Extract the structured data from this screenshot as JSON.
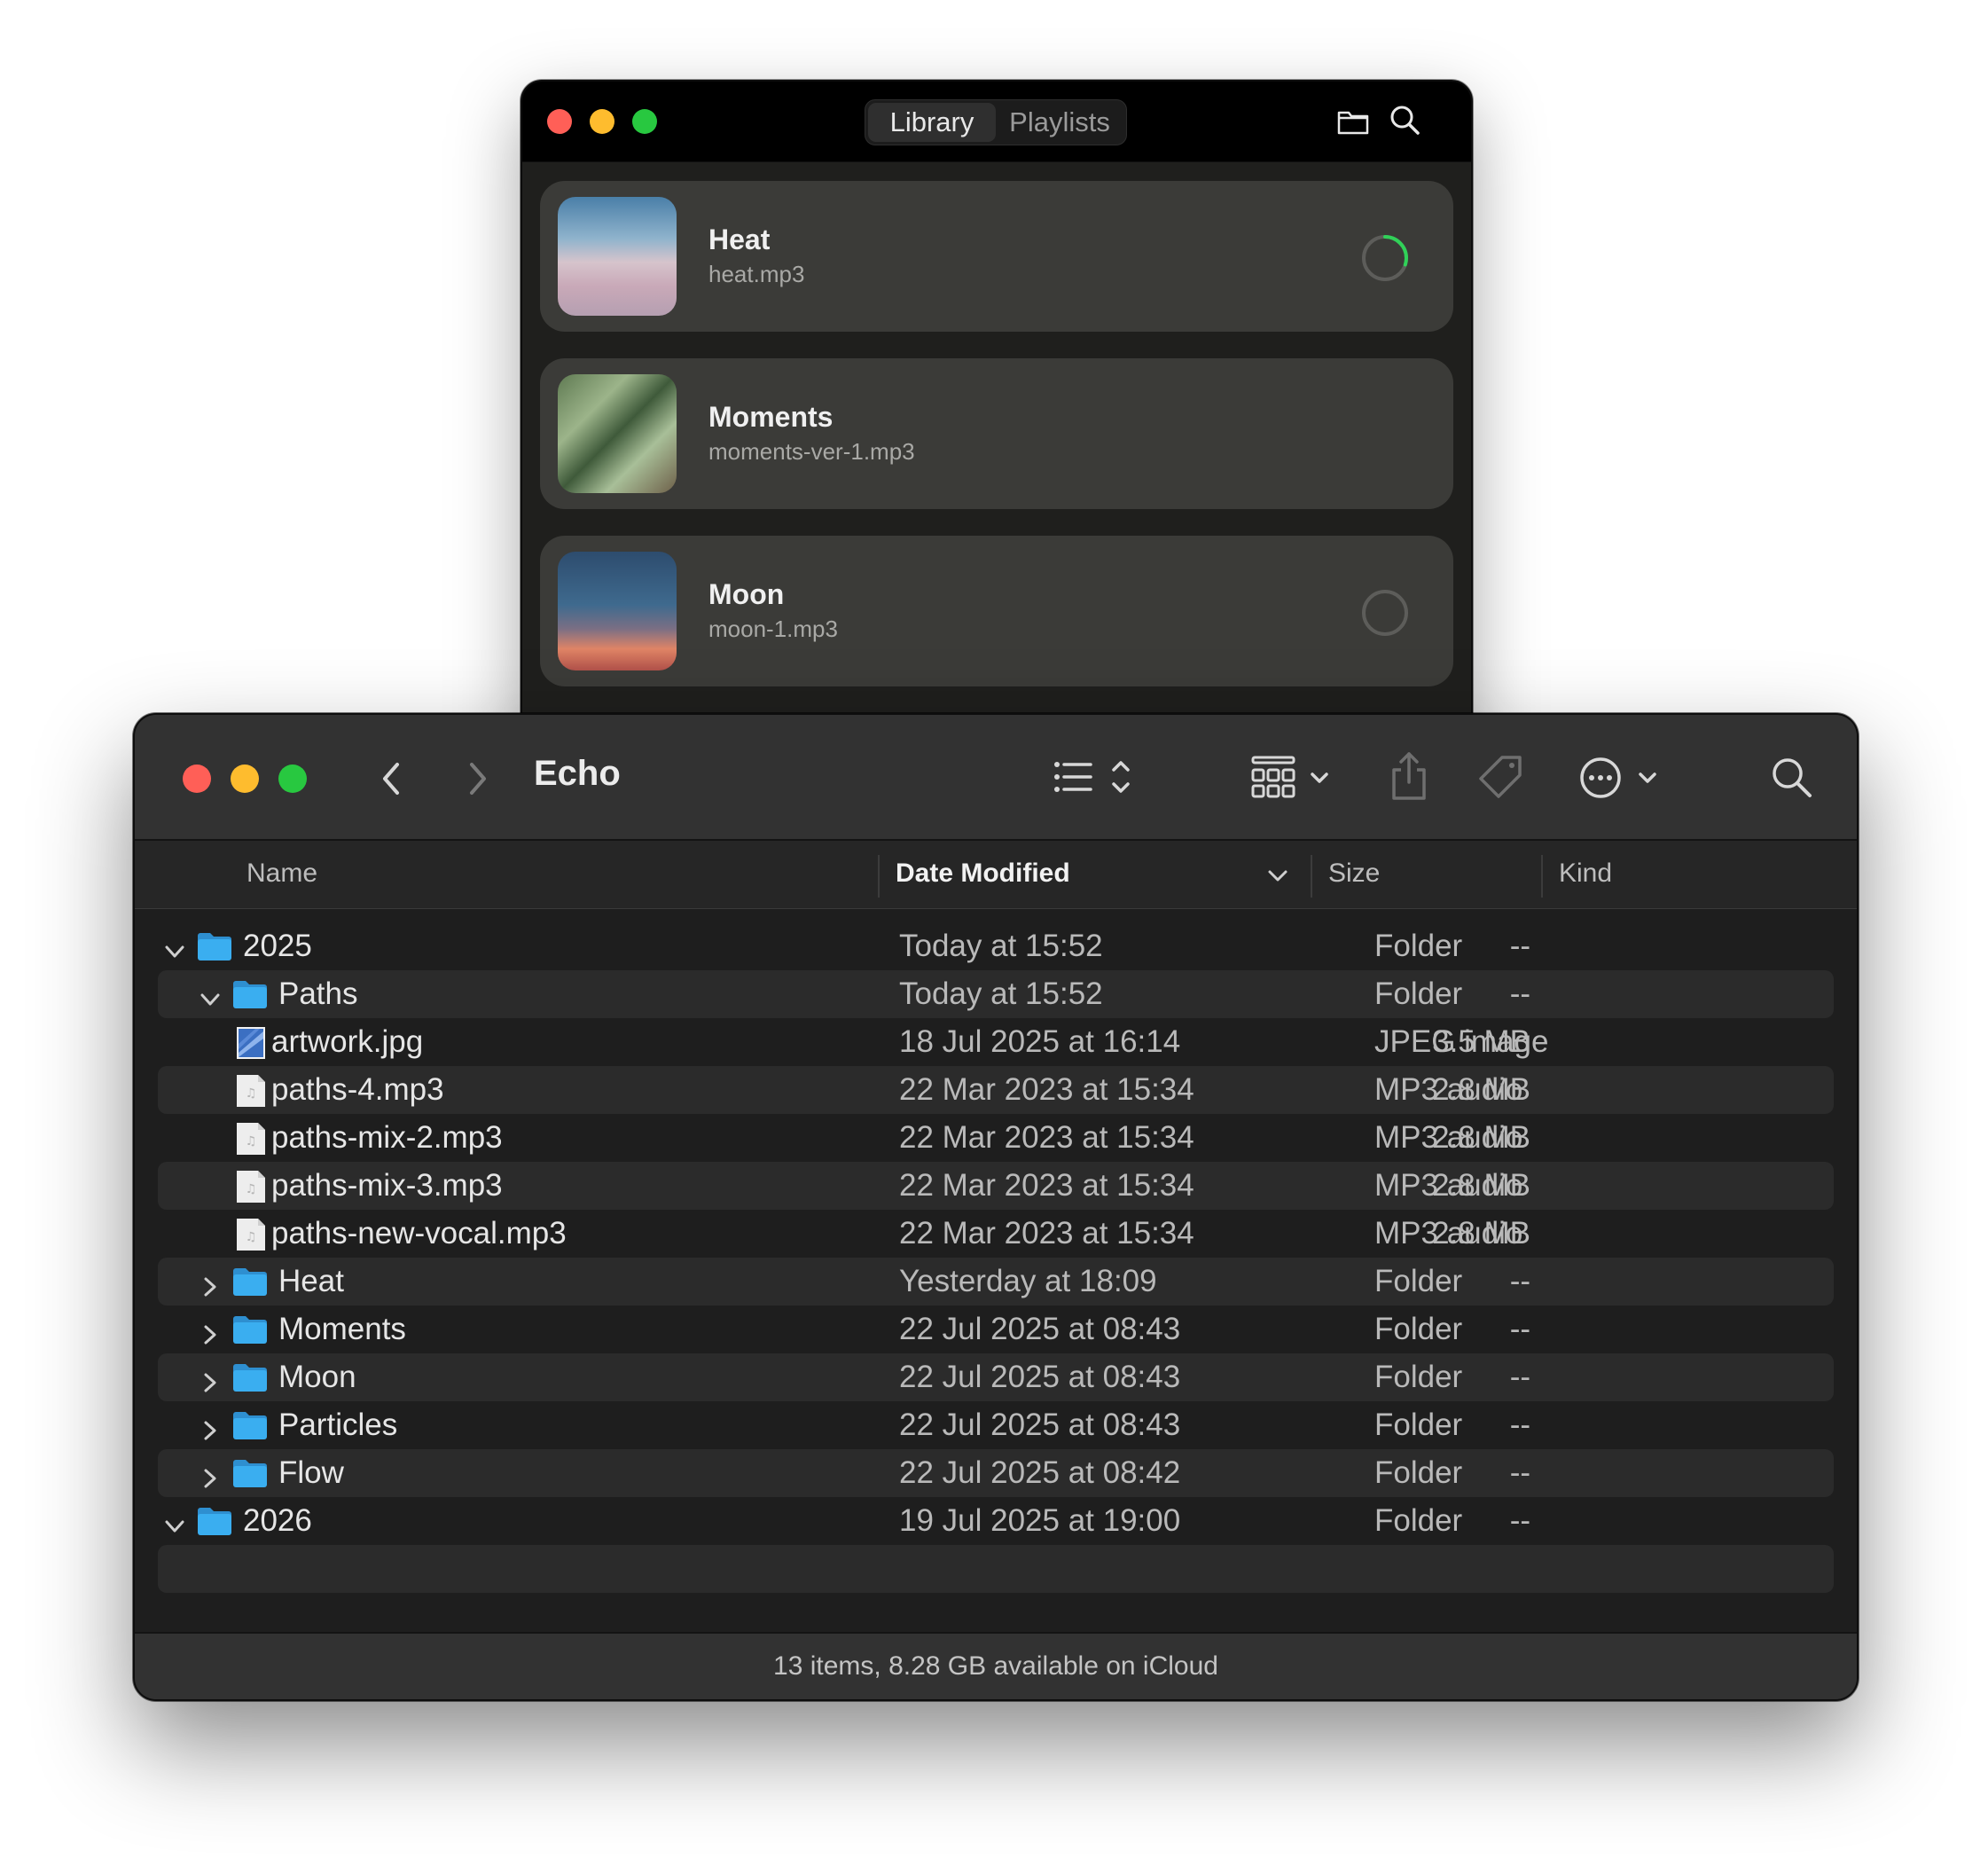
{
  "music_app": {
    "tabs": [
      "Library",
      "Playlists"
    ],
    "active_tab": "Library",
    "toolbar_icons": [
      "folder-icon",
      "search-icon"
    ],
    "tracks": [
      {
        "title": "Heat",
        "file": "heat.mp3",
        "status": "downloading",
        "progress": 0.3
      },
      {
        "title": "Moments",
        "file": "moments-ver-1.mp3",
        "status": "none"
      },
      {
        "title": "Moon",
        "file": "moon-1.mp3",
        "status": "not-downloaded"
      }
    ],
    "colors": {
      "accent": "#30d158",
      "card": "#3b3b38"
    }
  },
  "finder": {
    "title": "Echo",
    "toolbar_icons": [
      "back-icon",
      "forward-icon",
      "list-view-icon",
      "group-icon",
      "share-icon",
      "tag-icon",
      "more-icon",
      "search-icon"
    ],
    "columns": [
      "Name",
      "Date Modified",
      "Size",
      "Kind"
    ],
    "sort_column": "Date Modified",
    "rows": [
      {
        "name": "2025",
        "date": "Today at 15:52",
        "size": "--",
        "kind": "Folder",
        "type": "folder",
        "level": 0,
        "expanded": true
      },
      {
        "name": "Paths",
        "date": "Today at 15:52",
        "size": "--",
        "kind": "Folder",
        "type": "folder",
        "level": 1,
        "expanded": true
      },
      {
        "name": "artwork.jpg",
        "date": "18 Jul 2025 at 16:14",
        "size": "3.5 MB",
        "kind": "JPEG image",
        "type": "image",
        "level": 2
      },
      {
        "name": "paths-4.mp3",
        "date": "22 Mar 2023 at 15:34",
        "size": "2.8 MB",
        "kind": "MP3 audio",
        "type": "audio",
        "level": 2
      },
      {
        "name": "paths-mix-2.mp3",
        "date": "22 Mar 2023 at 15:34",
        "size": "2.8 MB",
        "kind": "MP3 audio",
        "type": "audio",
        "level": 2
      },
      {
        "name": "paths-mix-3.mp3",
        "date": "22 Mar 2023 at 15:34",
        "size": "2.8 MB",
        "kind": "MP3 audio",
        "type": "audio",
        "level": 2
      },
      {
        "name": "paths-new-vocal.mp3",
        "date": "22 Mar 2023 at 15:34",
        "size": "2.8 MB",
        "kind": "MP3 audio",
        "type": "audio",
        "level": 2
      },
      {
        "name": "Heat",
        "date": "Yesterday at 18:09",
        "size": "--",
        "kind": "Folder",
        "type": "folder",
        "level": 1,
        "expanded": false
      },
      {
        "name": "Moments",
        "date": "22 Jul 2025 at 08:43",
        "size": "--",
        "kind": "Folder",
        "type": "folder",
        "level": 1,
        "expanded": false
      },
      {
        "name": "Moon",
        "date": "22 Jul 2025 at 08:43",
        "size": "--",
        "kind": "Folder",
        "type": "folder",
        "level": 1,
        "expanded": false
      },
      {
        "name": "Particles",
        "date": "22 Jul 2025 at 08:43",
        "size": "--",
        "kind": "Folder",
        "type": "folder",
        "level": 1,
        "expanded": false
      },
      {
        "name": "Flow",
        "date": "22 Jul 2025 at 08:42",
        "size": "--",
        "kind": "Folder",
        "type": "folder",
        "level": 1,
        "expanded": false
      },
      {
        "name": "2026",
        "date": "19 Jul 2025 at 19:00",
        "size": "--",
        "kind": "Folder",
        "type": "folder",
        "level": 0,
        "expanded": true
      }
    ],
    "status": "13 items, 8.28 GB available on iCloud",
    "colors": {
      "folder": "#3aaef0"
    }
  }
}
